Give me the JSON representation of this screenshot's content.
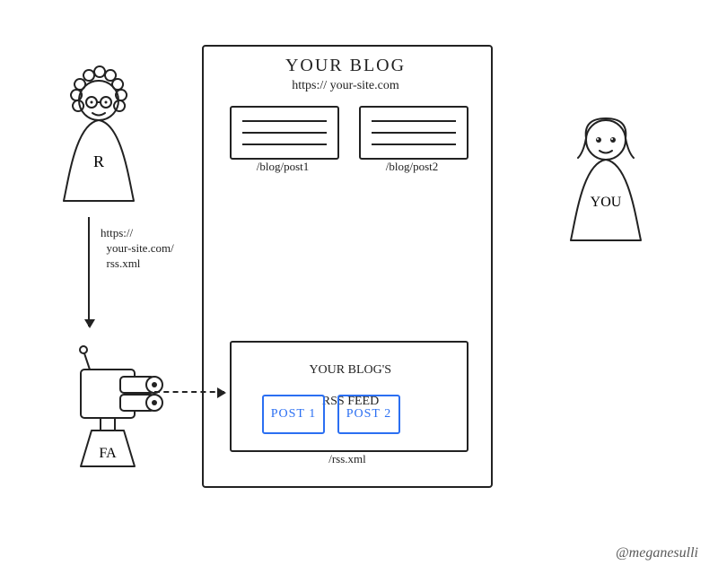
{
  "blog": {
    "title": "YOUR BLOG",
    "url": "https:// your-site.com",
    "posts": [
      {
        "path": "/blog/post1"
      },
      {
        "path": "/blog/post2"
      }
    ],
    "rss": {
      "title_line1": "YOUR BLOG'S",
      "title_line2": "RSS FEED",
      "items": [
        "POST 1",
        "POST 2"
      ],
      "path": "/rss.xml"
    }
  },
  "reader": {
    "initial": "R"
  },
  "you": {
    "label": "YOU"
  },
  "robot": {
    "label": "FA"
  },
  "arrow_label": "https://\n  your-site.com/\n  rss.xml",
  "credit": "@meganesulli"
}
